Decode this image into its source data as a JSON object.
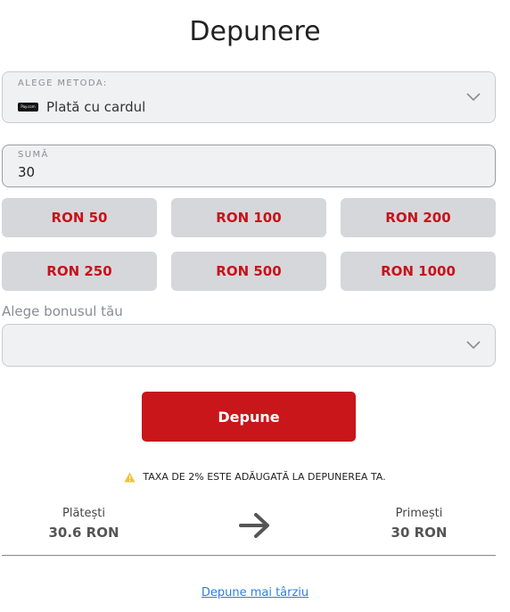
{
  "title": "Depunere",
  "method": {
    "label": "ALEGE METODA:",
    "logo_text": "Pay.com",
    "value": "Plată cu cardul"
  },
  "amount": {
    "label": "SUMĂ",
    "value": "30"
  },
  "quick_amounts": [
    "RON 50",
    "RON 100",
    "RON 200",
    "RON 250",
    "RON 500",
    "RON 1000"
  ],
  "bonus": {
    "label": "Alege bonusul tău",
    "value": ""
  },
  "submit_label": "Depune",
  "fee_notice": "TAXA DE 2% ESTE ADĂUGATĂ LA DEPUNEREA TA.",
  "summary": {
    "pay_label": "Plătești",
    "pay_value": "30.6 RON",
    "receive_label": "Primești",
    "receive_value": "30 RON"
  },
  "later_link": "Depune mai târziu",
  "colors": {
    "accent": "#c8161b",
    "button_bg": "#d6d7da",
    "link": "#2f7ddf",
    "warning": "#f2c230"
  },
  "icons": [
    "pay-logo-icon",
    "chevron-down-icon",
    "warning-icon",
    "arrow-right-icon"
  ]
}
